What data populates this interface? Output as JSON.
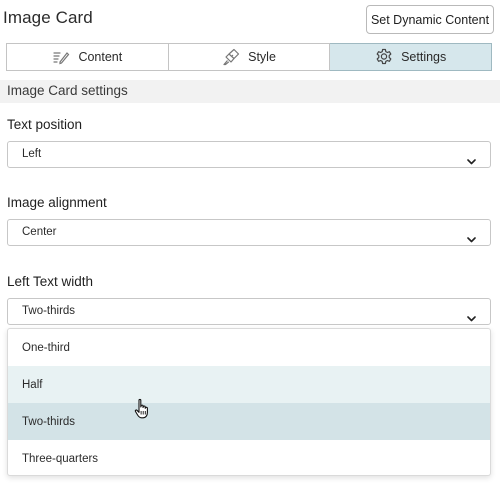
{
  "header": {
    "title": "Image Card",
    "dynamic_button_label": "Set Dynamic Content"
  },
  "tabs": [
    {
      "label": "Content",
      "icon": "edit-icon",
      "active": false
    },
    {
      "label": "Style",
      "icon": "paint-brush-icon",
      "active": false
    },
    {
      "label": "Settings",
      "icon": "gear-icon",
      "active": true
    }
  ],
  "section": {
    "title": "Image Card settings"
  },
  "fields": {
    "text_position": {
      "label": "Text position",
      "value": "Left"
    },
    "image_alignment": {
      "label": "Image alignment",
      "value": "Center"
    },
    "text_width": {
      "label": "Left Text width",
      "value": "Two-thirds"
    }
  },
  "dropdown": {
    "options": [
      "One-third",
      "Half",
      "Two-thirds",
      "Three-quarters"
    ],
    "hovered": "Half",
    "selected": "Two-thirds"
  },
  "colors": {
    "active_tab": "#d6e7ec",
    "option_hover": "#e8f2f3",
    "option_selected": "#d3e3e7"
  }
}
